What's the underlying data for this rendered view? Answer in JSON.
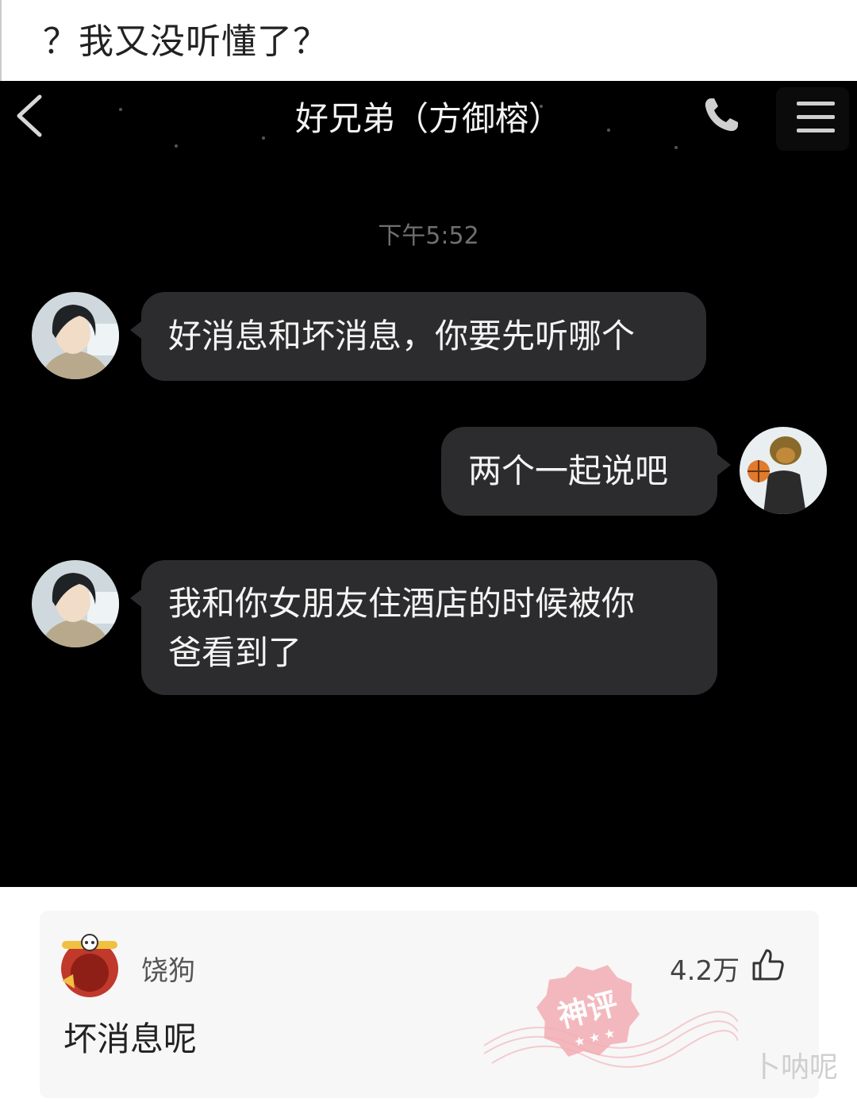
{
  "caption": {
    "text": "？我又没听懂了？"
  },
  "chat_header": {
    "title": "好兄弟（方御榕）",
    "back_icon": "chevron-left-icon",
    "call_icon": "phone-icon",
    "menu_icon": "menu-icon"
  },
  "chat": {
    "timestamp": "下午5:52",
    "messages": [
      {
        "side": "left",
        "lines": [
          "好消息和坏消息，你要先听哪个"
        ]
      },
      {
        "side": "right",
        "lines": [
          "两个一起说吧"
        ]
      },
      {
        "side": "left",
        "lines": [
          "我和你女朋友住酒店的时候被你",
          "爸看到了"
        ]
      }
    ]
  },
  "comment": {
    "username": "饶狗",
    "likes": "4.2万",
    "like_icon": "thumbs-up-icon",
    "text": "坏消息呢",
    "badge_text": "神评"
  },
  "watermark": "卜呐呢",
  "colors": {
    "chat_background": "#000000",
    "bubble": "#2c2c2e",
    "stamp": "#f2a0a8"
  }
}
